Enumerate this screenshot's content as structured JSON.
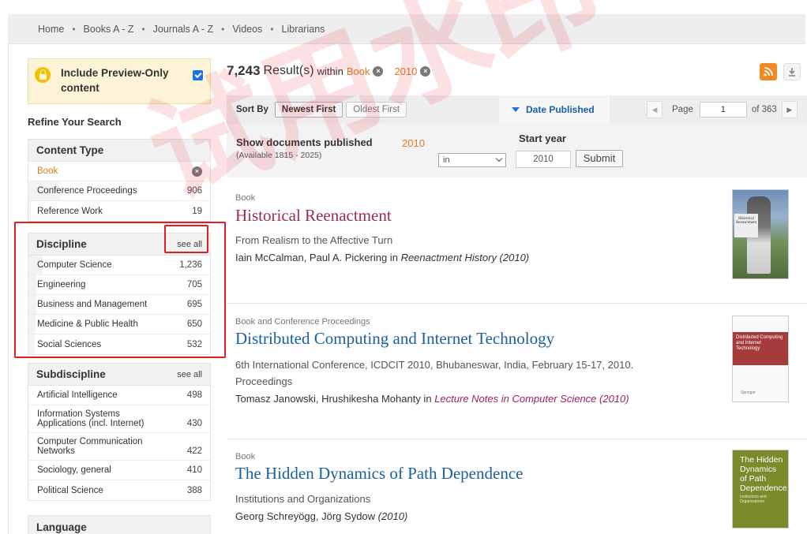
{
  "nav": {
    "items": [
      "Home",
      "Books A - Z",
      "Journals A - Z",
      "Videos",
      "Librarians"
    ],
    "separator": "•"
  },
  "preview": {
    "label": "Include Preview-Only content",
    "checked": true
  },
  "refine_title": "Refine Your Search",
  "facets": {
    "content_type": {
      "title": "Content Type",
      "active": {
        "label": "Book",
        "remove_symbol": "×"
      },
      "items": [
        {
          "label": "Conference Proceedings",
          "count": "906"
        },
        {
          "label": "Reference Work",
          "count": "19"
        }
      ]
    },
    "discipline": {
      "title": "Discipline",
      "see_all": "see all",
      "items": [
        {
          "label": "Computer Science",
          "count": "1,236"
        },
        {
          "label": "Engineering",
          "count": "705"
        },
        {
          "label": "Business and Management",
          "count": "695"
        },
        {
          "label": "Medicine & Public Health",
          "count": "650"
        },
        {
          "label": "Social Sciences",
          "count": "532"
        }
      ]
    },
    "subdiscipline": {
      "title": "Subdiscipline",
      "see_all": "see all",
      "items": [
        {
          "label": "Artificial Intelligence",
          "count": "498"
        },
        {
          "label": "Information Systems Applications (incl. Internet)",
          "count": "430"
        },
        {
          "label": "Computer Communication Networks",
          "count": "422"
        },
        {
          "label": "Sociology, general",
          "count": "410"
        },
        {
          "label": "Political Science",
          "count": "388"
        }
      ]
    },
    "language": {
      "title": "Language"
    }
  },
  "results_header": {
    "count": "7,243",
    "word": "Result(s)",
    "within": "within",
    "filters": [
      "Book",
      "2010"
    ],
    "remove_symbol": "×"
  },
  "sortbar": {
    "label": "Sort By",
    "newest": "Newest First",
    "oldest": "Oldest First",
    "date_tab": "Date Published",
    "page_label": "Page",
    "page_value": "1",
    "page_total": "of 363",
    "prev_symbol": "◀",
    "next_symbol": "▶"
  },
  "date_filter": {
    "title": "Show documents published",
    "available": "(Available 1815 - 2025)",
    "year_tag": "2010",
    "mode": "in",
    "start_label": "Start year",
    "start_value": "2010",
    "submit": "Submit"
  },
  "results": [
    {
      "type": "Book",
      "title": "Historical Reenactment",
      "subtitle": "From Realism to the Affective Turn",
      "authors": "Iain McCalman, Paul A. Pickering in",
      "publication": "Reenactment History (2010)",
      "cover_text": "Historical Reenactment"
    },
    {
      "type": "Book and Conference Proceedings",
      "title": "Distributed Computing and Internet Technology",
      "subtitle": "6th International Conference, ICDCIT 2010, Bhubaneswar, India, February 15-17, 2010.",
      "subtitle2": "Proceedings",
      "authors": "Tomasz Janowski, Hrushikesha Mohanty in",
      "publication": "Lecture Notes in Computer Science (2010)",
      "cover_text": "Distributed Computing and Internet Technology",
      "cover_brand": "Springer"
    },
    {
      "type": "Book",
      "title": "The Hidden Dynamics of Path Dependence",
      "subtitle": "Institutions and Organizations",
      "authors": "Georg Schreyögg, Jörg Sydow",
      "publication": "(2010)",
      "cover_text": "The Hidden Dynamics of Path Dependence",
      "cover_sub": "Institutions and Organizations"
    }
  ],
  "watermark": "试用水印",
  "colors": {
    "accent_orange": "#e07a1e",
    "link_blue": "#1a5f9e",
    "visited": "#9b2a5d",
    "highlight_red": "#e31b23"
  }
}
